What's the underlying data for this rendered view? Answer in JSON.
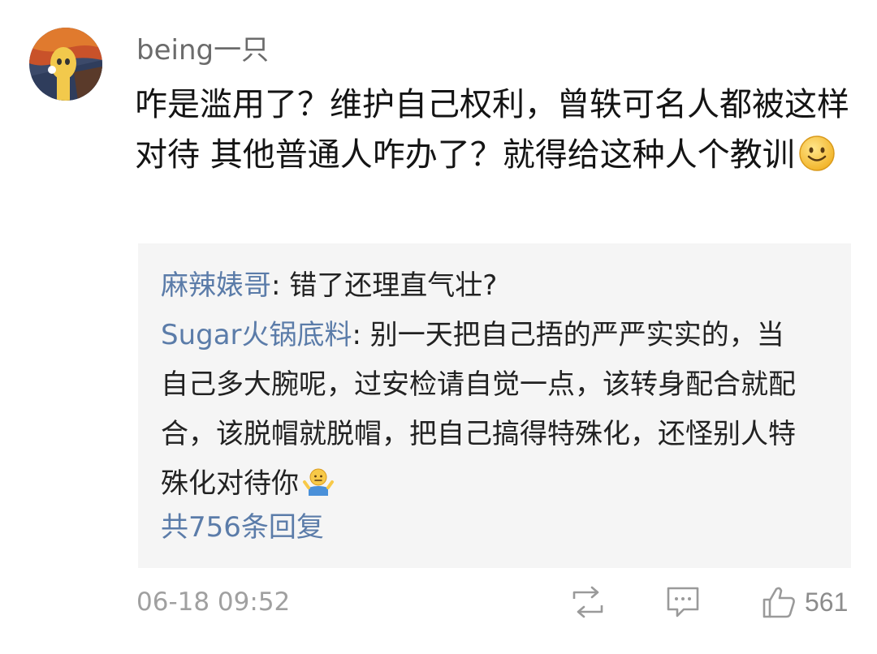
{
  "comment": {
    "username": "being一只",
    "text": "咋是滥用了？维护自己权利，曾轶可名人都被这样对待 其他普通人咋办了？就得给这种人个教训",
    "emoji": "smile-emoji",
    "timestamp": "06-18 09:52",
    "like_count": "561"
  },
  "replies": [
    {
      "name": "麻辣婊哥",
      "separator": ": ",
      "text": "错了还理直气壮?"
    },
    {
      "name": "Sugar火锅底料",
      "separator": ": ",
      "text": "别一天把自己捂的严严实实的，当自己多大腕呢，过安检请自觉一点，该转身配合就配合，该脱帽就脱帽，把自己搞得特殊化，还怪别人特殊化对待你",
      "emoji": "shrug-emoji"
    }
  ],
  "reply_count_label": "共756条回复",
  "actions": {
    "repost_icon": "repost-icon",
    "comment_icon": "comment-icon",
    "like_icon": "thumbs-up-icon"
  },
  "colors": {
    "link": "#5b7ca9",
    "reply_bg": "#f5f5f5",
    "meta": "#a0a0a0"
  }
}
